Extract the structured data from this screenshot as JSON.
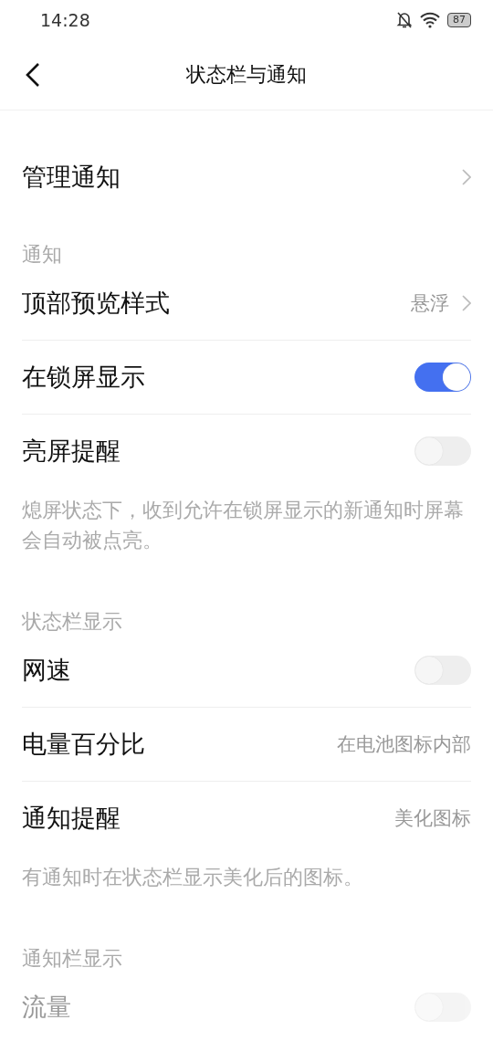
{
  "status_bar": {
    "time": "14:28",
    "battery": "87"
  },
  "header": {
    "title": "状态栏与通知"
  },
  "items": [
    {
      "kind": "nav",
      "label": "管理通知",
      "big": true
    },
    {
      "kind": "section",
      "label": "通知"
    },
    {
      "kind": "nav",
      "label": "顶部预览样式",
      "value": "悬浮"
    },
    {
      "kind": "toggle",
      "label": "在锁屏显示",
      "on": true,
      "disabled": false
    },
    {
      "kind": "toggle",
      "label": "亮屏提醒",
      "on": false,
      "disabled": false
    },
    {
      "kind": "note",
      "label": "熄屏状态下，收到允许在锁屏显示的新通知时屏幕会自动被点亮。"
    },
    {
      "kind": "section",
      "label": "状态栏显示"
    },
    {
      "kind": "toggle",
      "label": "网速",
      "on": false,
      "disabled": false
    },
    {
      "kind": "value",
      "label": "电量百分比",
      "value": "在电池图标内部"
    },
    {
      "kind": "value",
      "label": "通知提醒",
      "value": "美化图标"
    },
    {
      "kind": "note",
      "label": "有通知时在状态栏显示美化后的图标。"
    },
    {
      "kind": "section",
      "label": "通知栏显示"
    },
    {
      "kind": "toggle",
      "label": "流量",
      "on": false,
      "disabled": true
    }
  ]
}
